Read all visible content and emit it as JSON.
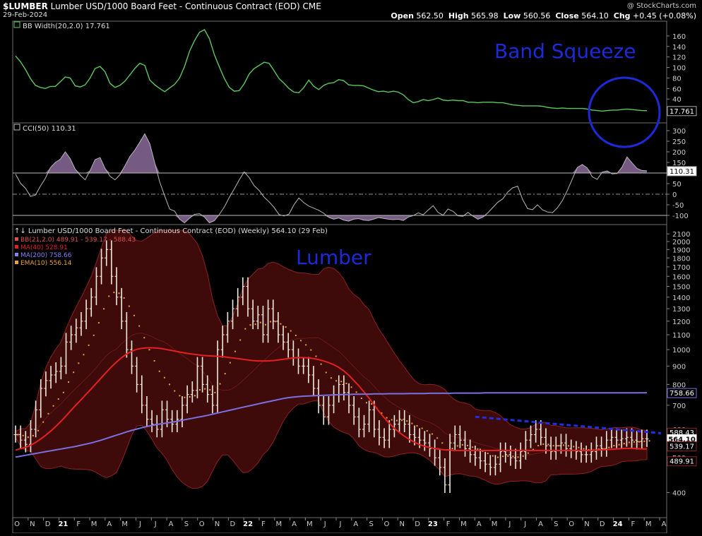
{
  "header": {
    "symbol": "$LUMBER",
    "title": "Lumber USD/1000 Board Feet - Continuous Contract (EOD)",
    "exchange": "CME",
    "date": "29-Feb-2024",
    "brand": "@ StockCharts.com",
    "ohlc": {
      "open_label": "Open",
      "open": "562.50",
      "high_label": "High",
      "high": "565.98",
      "low_label": "Low",
      "low": "560.56",
      "close_label": "Close",
      "close": "564.10",
      "chg_label": "Chg",
      "chg": "+0.45 (+0.08%)"
    }
  },
  "colors": {
    "background": "#000000",
    "bbw_line": "#5ec85e",
    "cci_fill": "#8a6a9a",
    "cci_line": "#b8b8b8",
    "price_bars": "#f2e8dc",
    "bb_fill": "#3e0a0a",
    "bb_band": "#8b2222",
    "ma40": "#e52020",
    "ma200": "#7a70e0",
    "ema10": "#e8a040",
    "annotation": "#1c2ad8",
    "trendline": "#2030e0"
  },
  "annotations": {
    "band_squeeze": "Band Squeeze",
    "lumber": "Lumber"
  },
  "chart_data": [
    {
      "type": "line",
      "legend": "BB Width(20,2.0) 17.761",
      "last_value_label": "17.761",
      "y_ticks": [
        "160",
        "140",
        "120",
        "100",
        "80",
        "60",
        "40",
        "20"
      ],
      "ylim": [
        0,
        180
      ],
      "series": [
        {
          "values": [
            122,
            111,
            96,
            79,
            66,
            62,
            60,
            64,
            64,
            73,
            82,
            80,
            65,
            63,
            67,
            80,
            98,
            102,
            92,
            70,
            62,
            66,
            74,
            86,
            98,
            108,
            104,
            76,
            67,
            60,
            54,
            61,
            68,
            80,
            102,
            131,
            151,
            167,
            172,
            155,
            124,
            101,
            79,
            62,
            55,
            56,
            69,
            88,
            98,
            104,
            110,
            108,
            94,
            79,
            70,
            60,
            53,
            52,
            62,
            76,
            64,
            58,
            66,
            70,
            71,
            77,
            75,
            67,
            66,
            66,
            65,
            61,
            57,
            54,
            55,
            53,
            55,
            53,
            48,
            39,
            33,
            35,
            39,
            37,
            39,
            42,
            38,
            37,
            38,
            37,
            37,
            34,
            34,
            33,
            34,
            34,
            34,
            33,
            33,
            31,
            29,
            28,
            27,
            27,
            27,
            27,
            26,
            24,
            23,
            22,
            23,
            22,
            22,
            22,
            22,
            21,
            19,
            18,
            17,
            18,
            19,
            19,
            20,
            21,
            20,
            19,
            18,
            17.8
          ]
        }
      ]
    },
    {
      "type": "area",
      "legend": "CCI(50) 110.31",
      "last_value_label": "110.31",
      "y_ticks": [
        "300",
        "250",
        "200",
        "150",
        "100",
        "50",
        "0",
        "-50",
        "-100"
      ],
      "ylim": [
        -130,
        330
      ],
      "reference_lines": [
        100,
        0,
        -100
      ],
      "series": [
        {
          "values": [
            95,
            52,
            28,
            -10,
            -4,
            38,
            75,
            125,
            150,
            165,
            200,
            168,
            118,
            90,
            68,
            112,
            163,
            173,
            122,
            85,
            68,
            92,
            134,
            178,
            208,
            246,
            285,
            238,
            148,
            58,
            -8,
            -70,
            -80,
            -118,
            -135,
            -113,
            -95,
            -92,
            -108,
            -135,
            -125,
            -95,
            -60,
            -15,
            25,
            68,
            105,
            78,
            40,
            18,
            -14,
            -36,
            -62,
            -96,
            -103,
            -94,
            -50,
            -18,
            -40,
            -56,
            -66,
            -76,
            -90,
            -109,
            -118,
            -112,
            -122,
            -127,
            -118,
            -115,
            -122,
            -124,
            -118,
            -110,
            -114,
            -118,
            -120,
            -118,
            -124,
            -108,
            -101,
            -88,
            -97,
            -75,
            -54,
            -86,
            -99,
            -70,
            -81,
            -102,
            -104,
            -86,
            -103,
            -118,
            -108,
            -88,
            -63,
            -38,
            -22,
            10,
            30,
            38,
            -25,
            -68,
            -73,
            -50,
            -74,
            -84,
            -87,
            -64,
            -30,
            18,
            72,
            126,
            140,
            124,
            82,
            70,
            104,
            110,
            96,
            98,
            128,
            176,
            148,
            122,
            112,
            110.3
          ]
        }
      ]
    },
    {
      "type": "bar",
      "legend_title": "Lumber USD/1000 Board Feet - Continuous Contract (EOD) (Weekly) 564.10 (29 Feb)",
      "legend_items": [
        {
          "label": "BB(21,2.0) 489.91 - 539.17 - 588.43",
          "color": "#e05050"
        },
        {
          "label": "MA(40) 528.91",
          "color": "#e52020"
        },
        {
          "label": "MA(200) 758.66",
          "color": "#8a80f0"
        },
        {
          "label": "EMA(10) 556.14",
          "color": "#e8a040"
        }
      ],
      "y_scale": "log",
      "ylim": [
        350,
        2150
      ],
      "y_ticks": [
        2100,
        2000,
        1900,
        1800,
        1700,
        1600,
        1500,
        1400,
        1300,
        1200,
        1100,
        1000,
        900,
        800,
        700,
        600,
        500,
        400
      ],
      "tick_skip": [
        2100
      ],
      "value_tags": [
        {
          "label": "758.66",
          "value": 758.66,
          "color": "#7a70e0"
        },
        {
          "label": "588.43",
          "value": 588.43,
          "color": "#8b2222"
        },
        {
          "label": "564.10",
          "value": 564.1,
          "color": "#ffffff"
        },
        {
          "label": "539.17",
          "value": 539.17,
          "color": "#8b2222"
        },
        {
          "label": "489.91",
          "value": 489.91,
          "color": "#8b2222"
        }
      ],
      "x_labels": [
        "O",
        "N",
        "D",
        "21",
        "F",
        "M",
        "A",
        "M",
        "J",
        "J",
        "A",
        "S",
        "O",
        "N",
        "D",
        "22",
        "F",
        "M",
        "A",
        "M",
        "J",
        "J",
        "A",
        "S",
        "O",
        "N",
        "D",
        "23",
        "F",
        "M",
        "A",
        "M",
        "J",
        "J",
        "A",
        "S",
        "O",
        "N",
        "D",
        "24",
        "F",
        "M",
        "A"
      ],
      "x_label_bold": [
        "21",
        "22",
        "23",
        "24"
      ],
      "close": [
        580,
        560,
        545,
        600,
        680,
        780,
        820,
        850,
        870,
        900,
        1050,
        1100,
        1150,
        1200,
        1300,
        1400,
        1600,
        1800,
        1900,
        1600,
        1400,
        1200,
        1000,
        900,
        800,
        700,
        640,
        620,
        600,
        680,
        640,
        620,
        640,
        700,
        750,
        770,
        900,
        800,
        750,
        700,
        1000,
        1100,
        1200,
        1300,
        1400,
        1500,
        1300,
        1200,
        1250,
        1100,
        1300,
        1200,
        1100,
        1050,
        1000,
        950,
        900,
        900,
        850,
        780,
        700,
        650,
        700,
        750,
        800,
        760,
        700,
        650,
        600,
        620,
        680,
        600,
        570,
        560,
        600,
        620,
        640,
        620,
        580,
        570,
        560,
        550,
        530,
        500,
        470,
        420,
        550,
        580,
        560,
        530,
        510,
        500,
        490,
        480,
        470,
        480,
        520,
        510,
        500,
        490,
        520,
        560,
        580,
        600,
        570,
        540,
        520,
        540,
        550,
        530,
        525,
        520,
        510,
        510,
        520,
        540,
        530,
        560,
        570,
        560,
        565,
        570,
        560,
        555,
        565,
        564
      ],
      "ma40": [
        525,
        530,
        535,
        542,
        552,
        564,
        578,
        594,
        612,
        632,
        654,
        678,
        702,
        726,
        752,
        778,
        806,
        836,
        866,
        896,
        924,
        950,
        972,
        990,
        1002,
        1008,
        1012,
        1012,
        1010,
        1006,
        1000,
        994,
        988,
        982,
        976,
        972,
        968,
        964,
        962,
        960,
        958,
        956,
        952,
        948,
        944,
        940,
        936,
        932,
        930,
        930,
        930,
        932,
        936,
        940,
        944,
        948,
        950,
        950,
        948,
        944,
        938,
        930,
        920,
        908,
        892,
        872,
        848,
        820,
        792,
        762,
        732,
        702,
        672,
        646,
        624,
        604,
        588,
        574,
        562,
        552,
        544,
        538,
        534,
        530,
        528,
        526,
        525,
        524,
        524,
        524,
        524,
        524,
        524,
        524,
        524,
        524,
        524,
        524,
        524,
        524,
        524,
        524,
        524,
        524,
        524,
        524,
        524,
        524,
        524,
        524,
        524,
        524,
        524,
        524,
        524,
        525,
        526,
        527,
        528,
        529,
        530,
        531,
        531,
        530,
        529,
        528.91
      ],
      "ma200": [
        502,
        505,
        508,
        511,
        514,
        517,
        520,
        523,
        526,
        529,
        532,
        535,
        538,
        542,
        546,
        550,
        555,
        560,
        566,
        572,
        578,
        584,
        590,
        596,
        601,
        606,
        611,
        615,
        619,
        622,
        625,
        628,
        632,
        636,
        640,
        644,
        648,
        652,
        656,
        661,
        666,
        671,
        676,
        681,
        686,
        691,
        696,
        701,
        706,
        711,
        716,
        721,
        726,
        731,
        735,
        738,
        740,
        742,
        743,
        744,
        745,
        746,
        747,
        748,
        749,
        750,
        750,
        751,
        751,
        752,
        752,
        753,
        753,
        753,
        754,
        754,
        754,
        754,
        755,
        755,
        755,
        755,
        756,
        756,
        756,
        756,
        756,
        757,
        757,
        757,
        757,
        757,
        757,
        758,
        758,
        758,
        758,
        758,
        758,
        758,
        758,
        758,
        758,
        758,
        758,
        758,
        758,
        758,
        758,
        758,
        758,
        758,
        758,
        758,
        758,
        758,
        758,
        758,
        758,
        758,
        758,
        758,
        758,
        758,
        758,
        758.66
      ],
      "trendline": {
        "from_value": 650,
        "to_value": 585
      }
    }
  ]
}
